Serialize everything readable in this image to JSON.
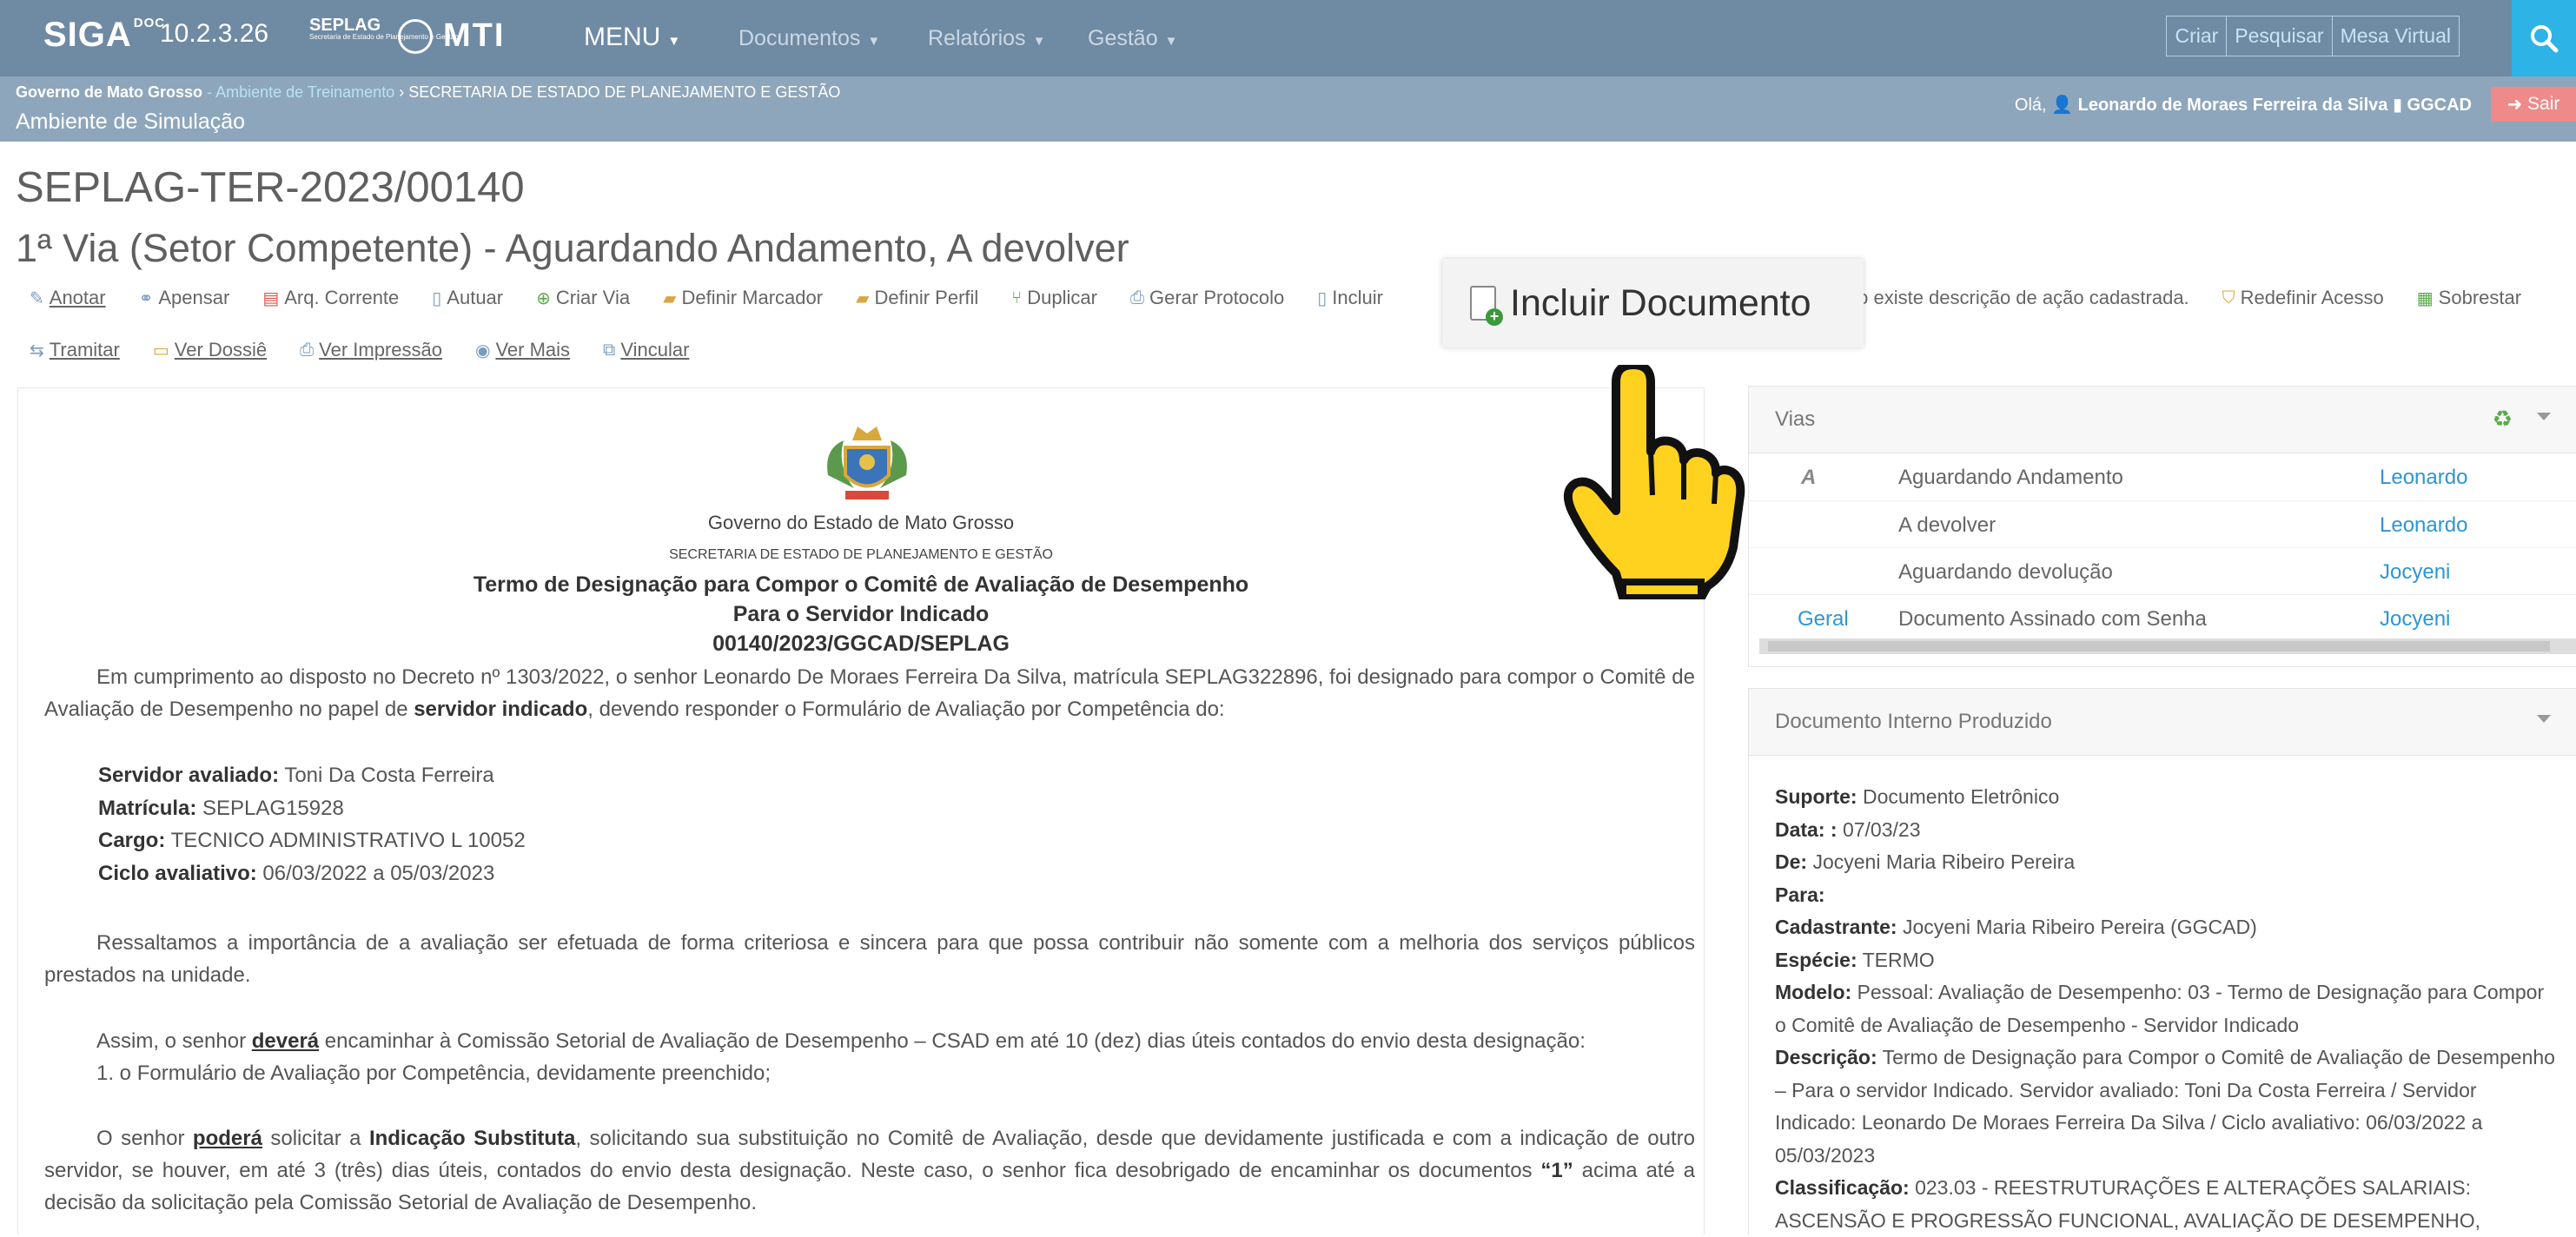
{
  "navbar": {
    "brand": "SIGA",
    "brand_sup": "DOC",
    "version": "10.2.3.26",
    "logo_seplag": "SEPLAG",
    "logo_seplag_sub": "Secretaria de Estado de Planejamento e Gestão",
    "logo_mti": "MTI",
    "menu_label": "MENU",
    "links": [
      "Documentos",
      "Relatórios",
      "Gestão"
    ],
    "buttons": [
      "Criar",
      "Pesquisar",
      "Mesa Virtual"
    ]
  },
  "subbar": {
    "org": "Governo de Mato Grosso",
    "ambiente": "Ambiente de Treinamento",
    "secretaria": "SECRETARIA DE ESTADO DE PLANEJAMENTO E GESTÃO",
    "environment": "Ambiente de Simulação",
    "greeting": "Olá,",
    "user_name": "Leonardo de Moraes Ferreira da Silva",
    "user_unit": "GGCAD",
    "logout": "Sair"
  },
  "doc_code": "SEPLAG-TER-2023/00140",
  "via_title": "1ª Via (Setor Competente) - Aguardando Andamento, A devolver",
  "toolbar_row1": [
    "Anotar",
    "Apensar",
    "Arq. Corrente",
    "Autuar",
    "Criar Via",
    "Definir Marcador",
    "Definir Perfil",
    "Duplicar",
    "Gerar Protocolo",
    "Incluir",
    "Não existe descrição de ação cadastrada.",
    "Redefinir Acesso",
    "Sobrestar"
  ],
  "toolbar_row2": [
    "Tramitar",
    "Ver Dossiê",
    "Ver Impressão",
    "Ver Mais",
    "Vincular"
  ],
  "popup_label": "Incluir Documento",
  "document": {
    "gov": "Governo do Estado de Mato Grosso",
    "sec": "SECRETARIA DE ESTADO DE PLANEJAMENTO E GESTÃO",
    "title1": "Termo de Designação para Compor o Comitê de Avaliação de Desempenho",
    "title2": "Para o Servidor Indicado",
    "title3": "00140/2023/GGCAD/SEPLAG",
    "p1_a": "Em cumprimento ao disposto no Decreto nº 1303/2022, o senhor Leonardo De Moraes Ferreira Da Silva, matrícula SEPLAG322896, foi designado para compor o Comitê de Avaliação de Desempenho no papel de ",
    "p1_b": "servidor indicado",
    "p1_c": ", devendo responder o Formulário de Avaliação por Competência do:",
    "servidor_label": "Servidor avaliado:",
    "servidor_value": "Toni Da Costa Ferreira",
    "matricula_label": "Matrícula:",
    "matricula_value": "SEPLAG15928",
    "cargo_label": "Cargo:",
    "cargo_value": "TECNICO ADMINISTRATIVO L 10052",
    "ciclo_label": "Ciclo avaliativo:",
    "ciclo_value": "06/03/2022 a 05/03/2023",
    "p2": "Ressaltamos a importância de a avaliação ser efetuada de forma criteriosa e sincera para que possa contribuir não somente com a melhoria dos serviços públicos prestados na unidade.",
    "p3_a": "Assim, o senhor ",
    "p3_b": "deverá",
    "p3_c": " encaminhar à Comissão Setorial de Avaliação de Desempenho – CSAD em até 10 (dez) dias úteis contados do envio desta designação:",
    "p3_item": "1. o Formulário de Avaliação por Competência, devidamente preenchido;",
    "p4_a": "O senhor ",
    "p4_b": "poderá",
    "p4_c": " solicitar a ",
    "p4_d": "Indicação Substituta",
    "p4_e": ", solicitando sua substituição no Comitê de Avaliação, desde que devidamente justificada e com a indicação de outro servidor, se houver, em até 3 (três) dias úteis, contados do envio desta designação. Neste caso, o senhor fica desobrigado de encaminhar os documentos ",
    "p4_f": "“1”",
    "p4_g": " acima até a decisão da solicitação pela Comissão Setorial de Avaliação de Desempenho."
  },
  "vias": {
    "title": "Vias",
    "rows": [
      {
        "via": "A",
        "status": "Aguardando Andamento",
        "person": "Leonardo"
      },
      {
        "via": "",
        "status": "A devolver",
        "person": "Leonardo"
      },
      {
        "via": "",
        "status": "Aguardando devolução",
        "person": "Jocyeni"
      },
      {
        "via": "Geral",
        "status": "Documento Assinado com Senha",
        "person": "Jocyeni"
      }
    ]
  },
  "info": {
    "title": "Documento Interno Produzido",
    "suporte_label": "Suporte:",
    "suporte_value": "Documento Eletrônico",
    "data_label": "Data: :",
    "data_value": "07/03/23",
    "de_label": "De:",
    "de_value": "Jocyeni Maria Ribeiro Pereira",
    "para_label": "Para:",
    "cad_label": "Cadastrante:",
    "cad_value": "Jocyeni Maria Ribeiro Pereira (GGCAD)",
    "esp_label": "Espécie:",
    "esp_value": "TERMO",
    "modelo_label": "Modelo:",
    "modelo_value": "Pessoal: Avaliação de Desempenho: 03 - Termo de Designação para Compor o Comitê de Avaliação de Desempenho - Servidor Indicado",
    "desc_label": "Descrição:",
    "desc_value": "Termo de Designação para Compor o Comitê de Avaliação de Desempenho – Para o servidor Indicado. Servidor avaliado: Toni Da Costa Ferreira / Servidor Indicado: Leonardo De Moraes Ferreira Da Silva / Ciclo avaliativo: 06/03/2022 a 05/03/2023",
    "class_label": "Classificação:",
    "class_value": "023.03 - REESTRUTURAÇÕES E ALTERAÇÕES SALARIAIS: ASCENSÃO E PROGRESSÃO FUNCIONAL, AVALIAÇÃO DE DESEMPENHO,"
  }
}
